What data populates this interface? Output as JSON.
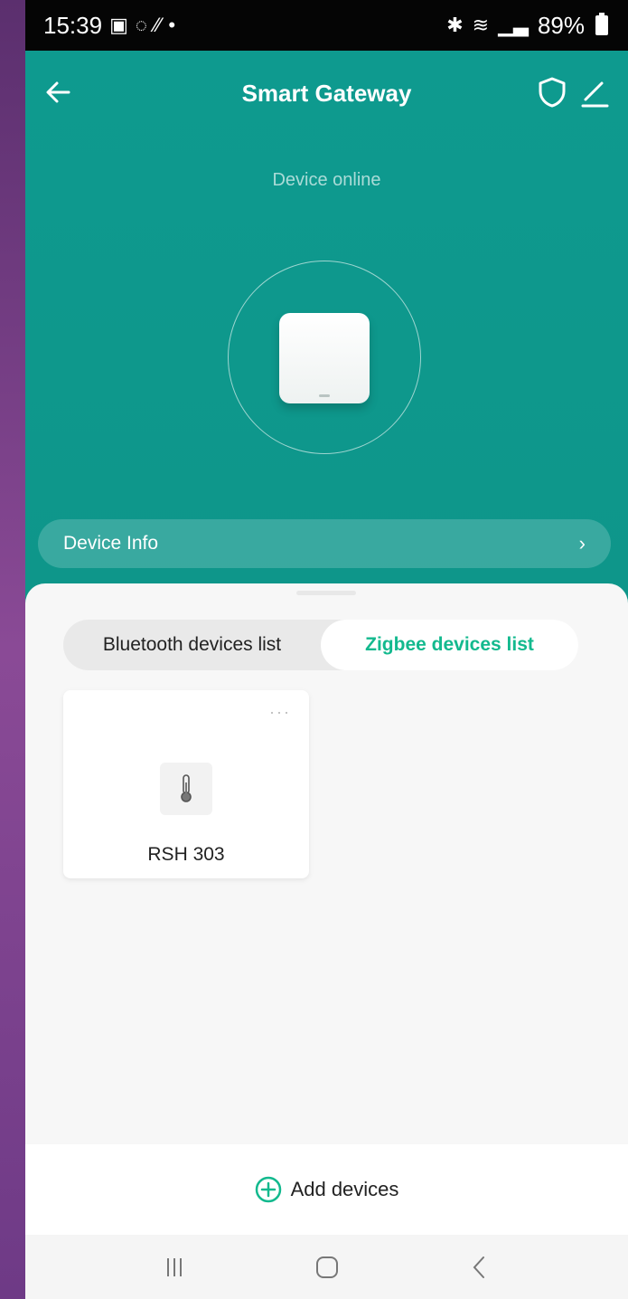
{
  "status_bar": {
    "time": "15:39",
    "battery": "89%",
    "left_icons": [
      "gallery-icon",
      "whatsapp-icon",
      "signal-slash-icon"
    ],
    "right_icons": [
      "bluetooth-icon",
      "wifi-icon",
      "signal-icon",
      "battery-icon"
    ]
  },
  "header": {
    "title": "Smart Gateway",
    "status": "Device online"
  },
  "device_info": {
    "label": "Device Info",
    "chevron": "›"
  },
  "tabs": [
    {
      "label": "Bluetooth devices list",
      "active": false
    },
    {
      "label": "Zigbee devices list",
      "active": true
    }
  ],
  "devices": [
    {
      "name": "RSH 303",
      "icon": "thermometer-icon",
      "more": "···"
    }
  ],
  "add_devices": {
    "label": "Add devices"
  },
  "colors": {
    "teal": "#0e9a8f",
    "accent_green": "#13b98e"
  }
}
